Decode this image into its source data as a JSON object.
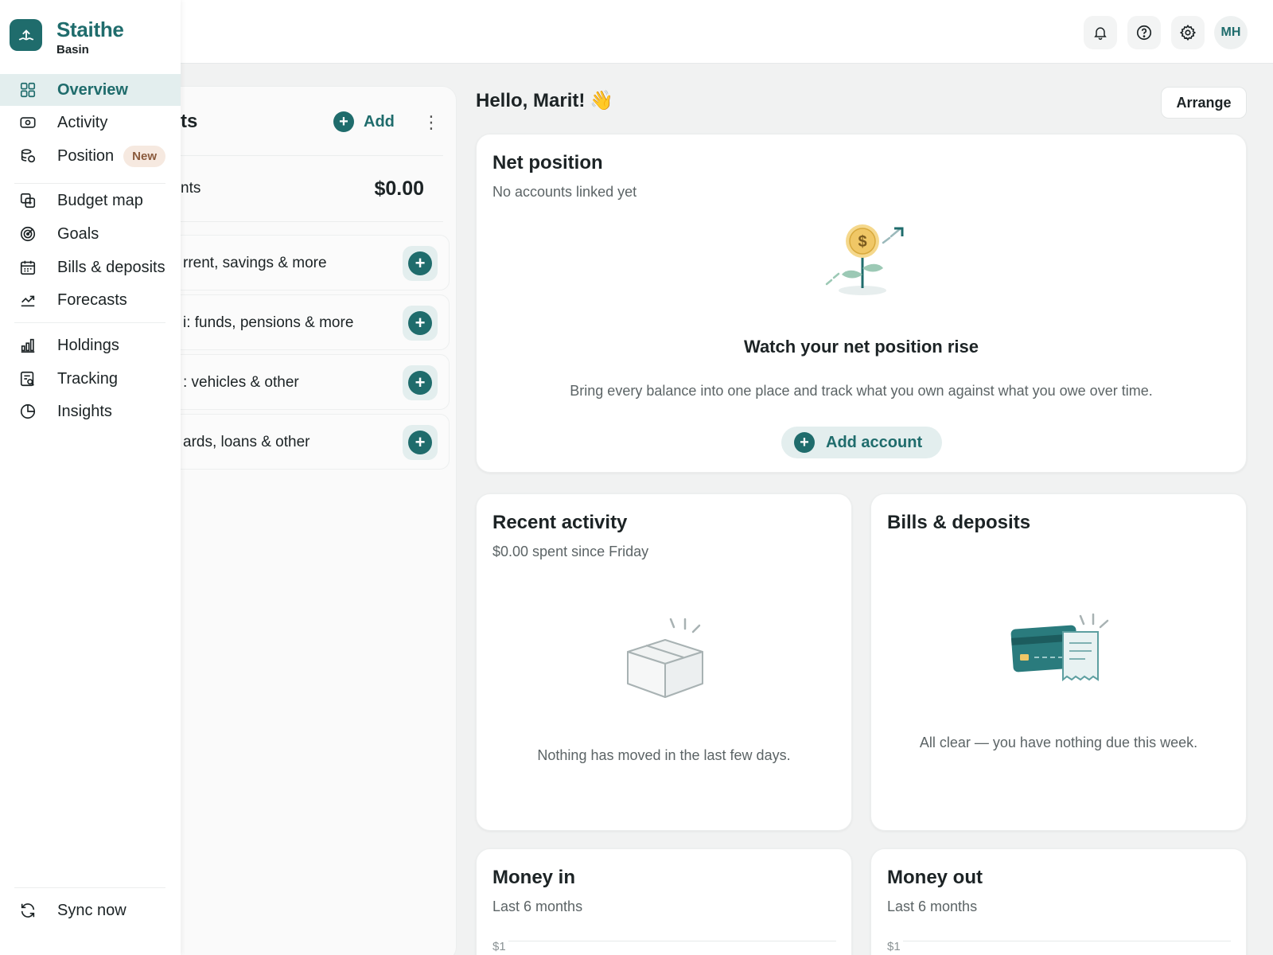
{
  "brand": {
    "name": "Staithe",
    "sub": "Basin"
  },
  "nav": {
    "overview": "Overview",
    "activity": "Activity",
    "position": "Position",
    "position_badge": "New",
    "budget_map": "Budget map",
    "goals": "Goals",
    "bills": "Bills & deposits",
    "forecasts": "Forecasts",
    "holdings": "Holdings",
    "tracking": "Tracking",
    "insights": "Insights",
    "sync": "Sync now"
  },
  "topbar": {
    "avatar_initials": "MH"
  },
  "accounts": {
    "title_fragment": "ts",
    "add_label": "Add",
    "total_label_fragment": "nts",
    "total_value": "$0.00",
    "rows": [
      "rrent, savings & more",
      "і: funds, pensions & more",
      ": vehicles & other",
      "ards, loans & other"
    ]
  },
  "greeting": {
    "text": "Hello, Marit!",
    "emoji": "👋"
  },
  "arrange_label": "Arrange",
  "net_position": {
    "title": "Net position",
    "subtitle": "No accounts linked yet",
    "headline": "Watch your net position rise",
    "description": "Bring every balance into one place and track what you own against what you owe over time.",
    "button": "Add account"
  },
  "recent_activity": {
    "title": "Recent activity",
    "subtitle": "$0.00 spent since Friday",
    "empty": "Nothing has moved in the last few days."
  },
  "bills_deposits": {
    "title": "Bills & deposits",
    "empty": "All clear — you have nothing due this week."
  },
  "money_in": {
    "title": "Money in",
    "subtitle": "Last 6 months",
    "axis_top": "$1"
  },
  "money_out": {
    "title": "Money out",
    "subtitle": "Last 6 months",
    "axis_top": "$1"
  },
  "colors": {
    "accent": "#1f6c6c",
    "accent_soft": "#e3eeee",
    "badge_bg": "#f6e9e0",
    "page_bg": "#f1f2f2"
  }
}
